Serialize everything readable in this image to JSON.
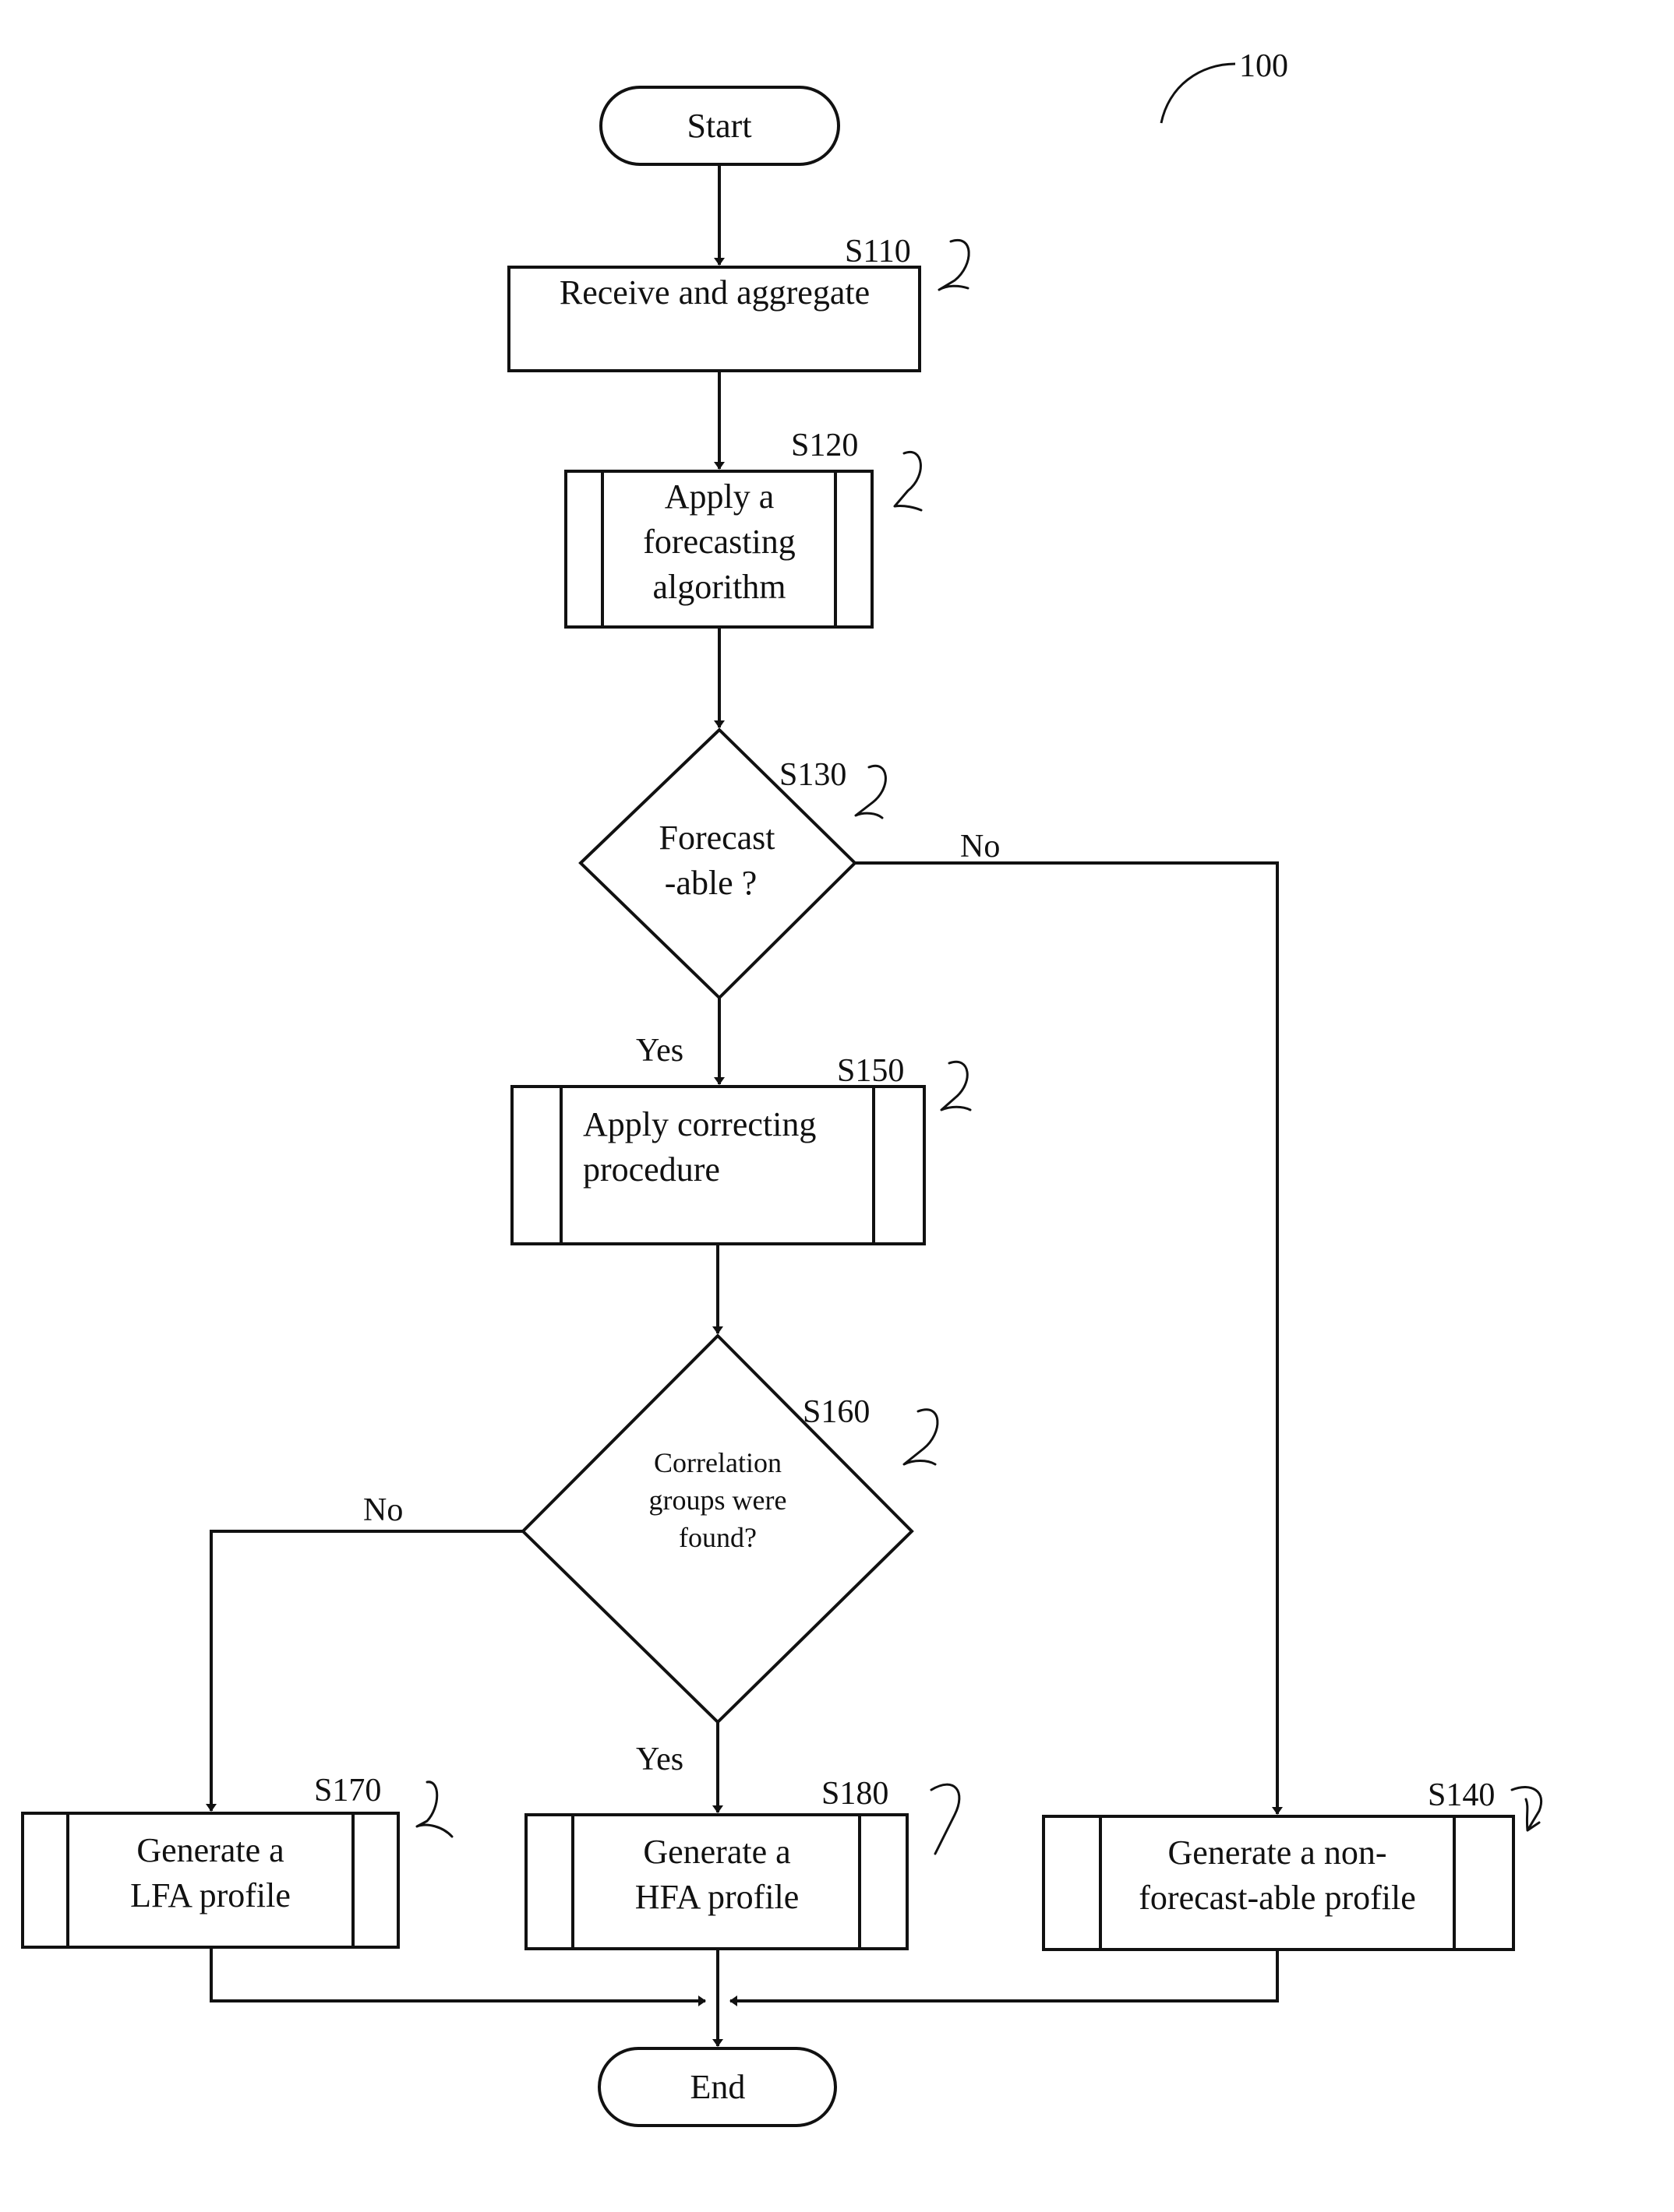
{
  "figure_ref": "100",
  "nodes": {
    "start": {
      "label": "Start"
    },
    "s110": {
      "ref": "S110",
      "lines": [
        "Receive and aggregate"
      ]
    },
    "s120": {
      "ref": "S120",
      "lines": [
        "Apply a",
        "forecasting",
        "algorithm"
      ]
    },
    "s130": {
      "ref": "S130",
      "lines": [
        "Forecast",
        "-able ?"
      ]
    },
    "s150": {
      "ref": "S150",
      "lines": [
        "Apply correcting",
        "procedure"
      ]
    },
    "s160": {
      "ref": "S160",
      "lines": [
        "Correlation",
        "groups were",
        "found?"
      ]
    },
    "s170": {
      "ref": "S170",
      "lines": [
        "Generate a",
        "LFA profile"
      ]
    },
    "s180": {
      "ref": "S180",
      "lines": [
        "Generate a",
        "HFA profile"
      ]
    },
    "s140": {
      "ref": "S140",
      "lines": [
        "Generate a non-",
        "forecast-able profile"
      ]
    },
    "end": {
      "label": "End"
    }
  },
  "edge_labels": {
    "s130_no": "No",
    "s130_yes": "Yes",
    "s160_no": "No",
    "s160_yes": "Yes"
  }
}
